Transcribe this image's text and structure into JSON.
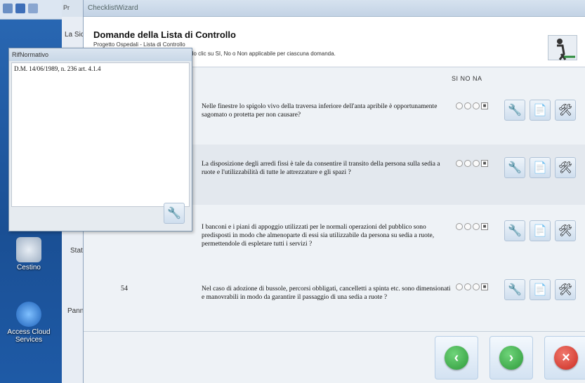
{
  "desktop": {
    "icons": [
      {
        "label": "Cestino"
      },
      {
        "label": "Access Cloud Services"
      }
    ]
  },
  "behind_app": {
    "tab": "Pr",
    "label_1": "La Sic",
    "label_state": "Stat",
    "label_panel": "Pann"
  },
  "wizard": {
    "window_title": "ChecklistWizard",
    "heading": "Domande della Lista di Controllo",
    "subheading": "Progetto Ospedali - Lista di Controllo",
    "instruction": "do clic su SI, No o Non applicabile per ciascuna domanda.",
    "col_headers": "SI NO NA",
    "questions": [
      {
        "number": "",
        "text": "Nelle finestre lo spigolo vivo della traversa inferiore dell'anta apribile è opportunamente sagomato o protetta per non causare?"
      },
      {
        "number": "",
        "text": "La disposizione degli arredi fissi è tale da consentire il transito della persona sulla sedia a ruote e l'utilizzabilità di tutte le attrezzature e gli spazi ?"
      },
      {
        "number": "",
        "text": "I banconi e i piani di appoggio utilizzati per le normali operazioni del pubblico sono predisposti in modo che almenoparte di essi sia utilizzabile da persona su sedia a ruote, permettendole di espletare tutti i servizi ?"
      },
      {
        "number": "54",
        "text": "Nel caso di adozione di bussole, percorsi obbligati, cancelletti a spinta etc. sono dimensionati e manovrabili in modo da garantire il passaggio di una sedia a ruote ?"
      }
    ]
  },
  "popup": {
    "title": "RifNormativo",
    "content": "D.M. 14/06/1989, n. 236 art. 4.1.4"
  },
  "colors": {
    "back": "#2e9a3a",
    "next": "#2e9a3a",
    "cancel": "#cc2a20"
  }
}
